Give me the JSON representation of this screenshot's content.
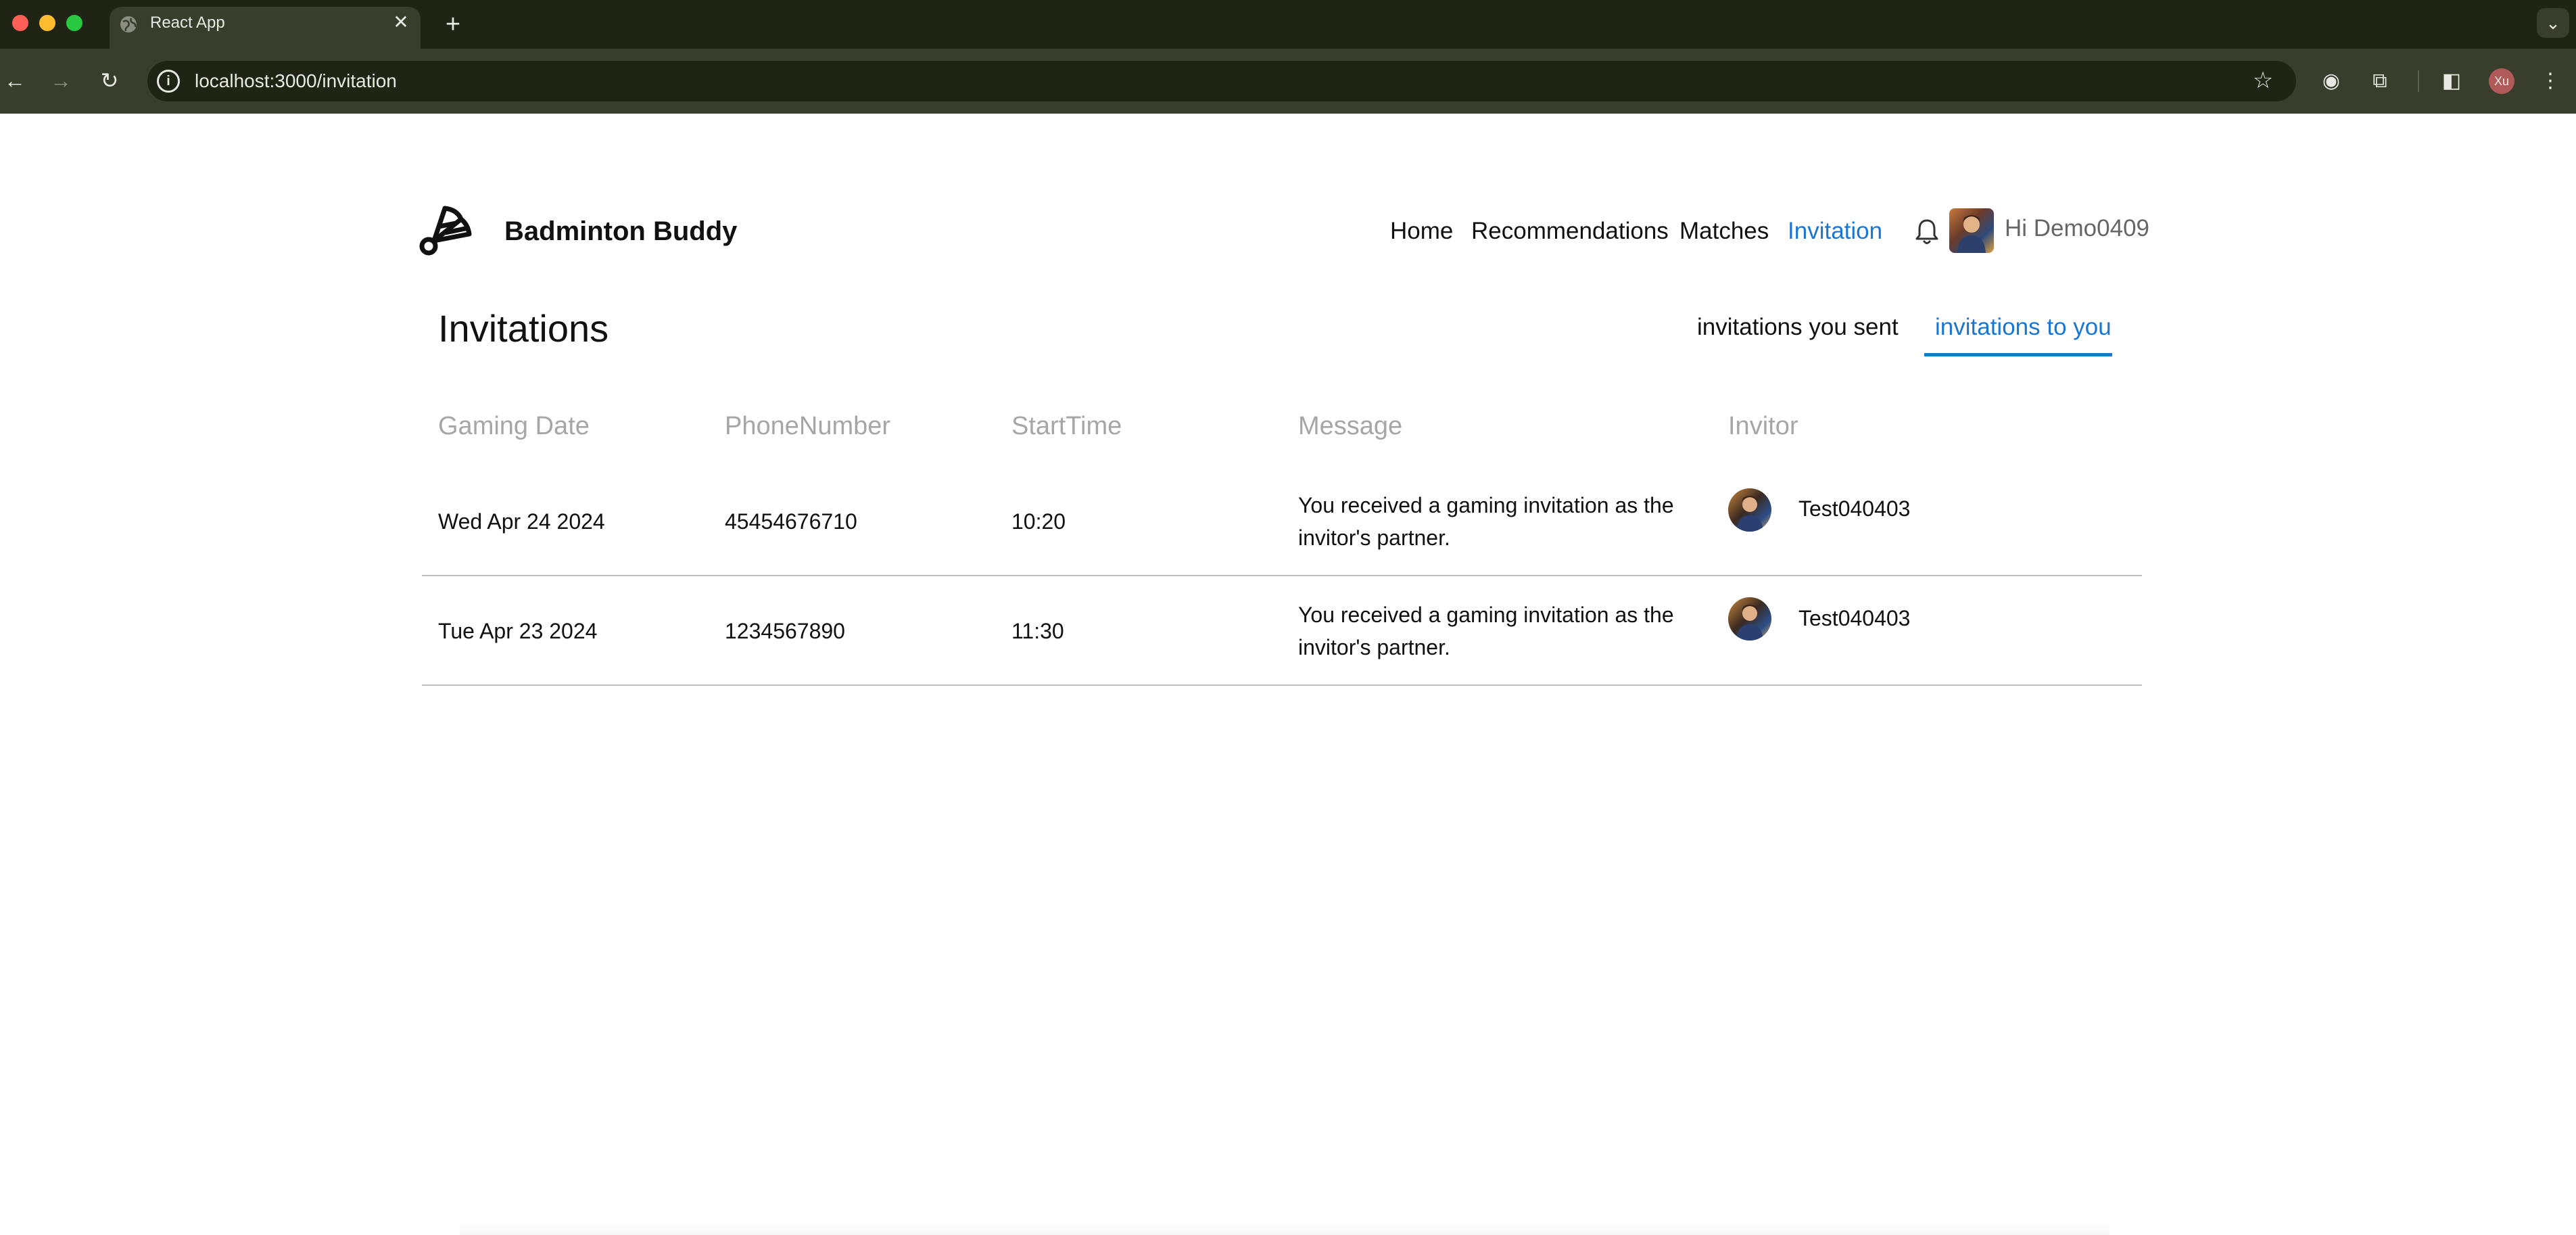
{
  "browser": {
    "tab_title": "React App",
    "tab_close": "✕",
    "new_tab": "+",
    "tab_search": "⌄",
    "url": "localhost:3000/invitation",
    "back": "←",
    "forward": "→",
    "reload": "↻",
    "info": "i",
    "star": "☆",
    "extension_1": "◉",
    "extension_2": "⧉",
    "side_panel": "◧",
    "profile_initials": "Xu",
    "menu": "⋮"
  },
  "header": {
    "brand": "Badminton Buddy",
    "nav": {
      "home": "Home",
      "recommendations": "Recommendations",
      "matches": "Matches",
      "invitation": "Invitation"
    },
    "greeting": "Hi Demo0409",
    "accent_color": "#1976d2"
  },
  "main": {
    "title": "Invitations",
    "tabs": {
      "sent": "invitations you sent",
      "to_you": "invitations to you",
      "active": "to_you"
    },
    "columns": {
      "date": "Gaming Date",
      "phone": "PhoneNumber",
      "time": "StartTime",
      "message": "Message",
      "invitor": "Invitor"
    },
    "rows": [
      {
        "date": "Wed Apr 24 2024",
        "phone": "45454676710",
        "time": "10:20",
        "message": "You received a gaming invitation as the invitor's partner.",
        "invitor": "Test040403"
      },
      {
        "date": "Tue Apr 23 2024",
        "phone": "1234567890",
        "time": "11:30",
        "message": "You received a gaming invitation as the invitor's partner.",
        "invitor": "Test040403"
      }
    ]
  }
}
